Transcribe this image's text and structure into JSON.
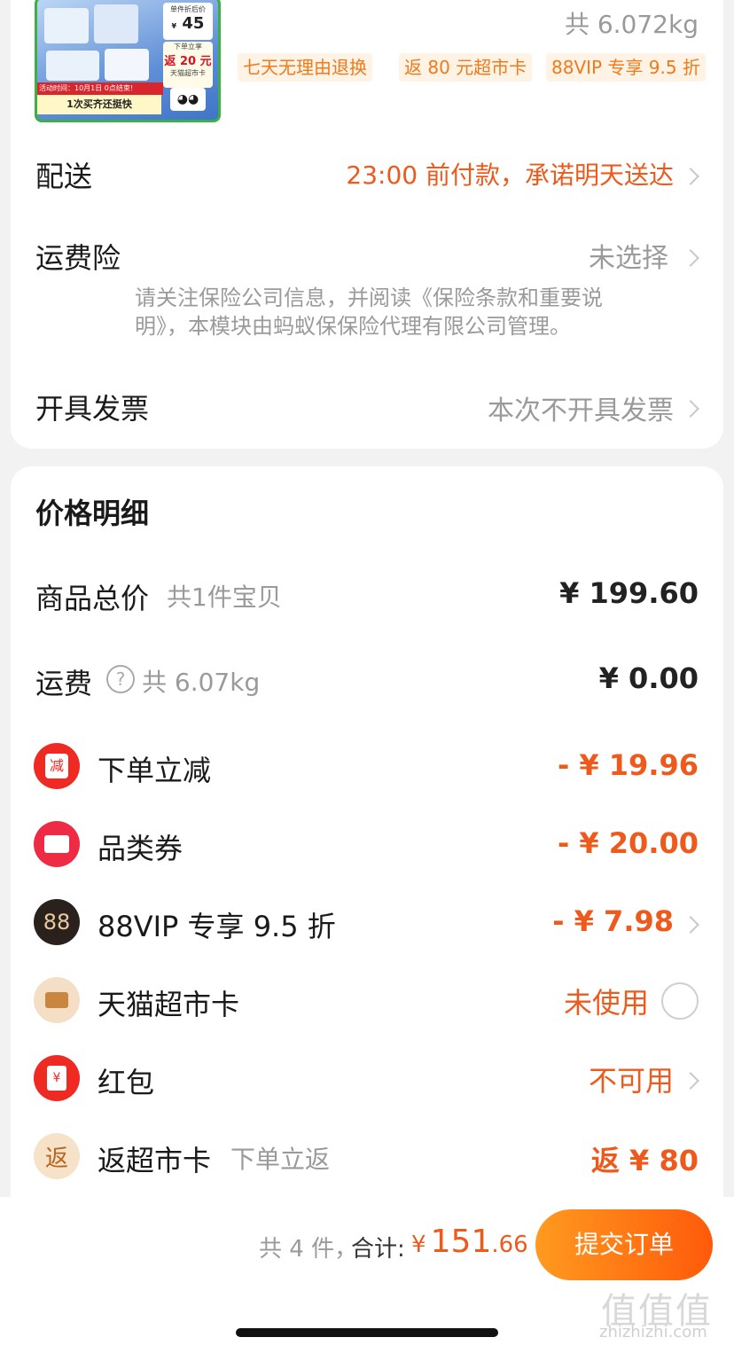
{
  "product": {
    "thumbnail": {
      "price_badge_title": "单件折后价",
      "price_badge_currency": "¥",
      "price_badge_value": "45",
      "rebate_line1": "下单立享",
      "rebate_line2": "返 20 元",
      "rebate_line3": "天猫超市卡",
      "event_text": "活动时间：10月1日 0点结束!",
      "slogan": "1次买齐还挺快"
    },
    "weight": "共 6.072kg",
    "tags": [
      "七天无理由退换",
      "返 80 元超市卡",
      "88VIP 专享 9.5 折"
    ]
  },
  "delivery": {
    "label": "配送",
    "value": "23:00 前付款，承诺明天送达"
  },
  "insurance": {
    "label": "运费险",
    "value": "未选择",
    "note_line1": "请关注保险公司信息，并阅读《保险条款和重要说",
    "note_line2": "明》，本模块由蚂蚁保保险代理有限公司管理。"
  },
  "invoice": {
    "label": "开具发票",
    "value": "本次不开具发票"
  },
  "price_detail": {
    "title": "价格明细",
    "goods_total": {
      "label": "商品总价",
      "sub": "共1件宝贝",
      "value": "¥ 199.60"
    },
    "shipping": {
      "label": "运费",
      "help_icon": "question-circle-icon",
      "sub": "共 6.07kg",
      "value": "¥ 0.00"
    },
    "discounts": [
      {
        "icon": "reduce-icon",
        "icon_text": "减",
        "label": "下单立减",
        "value": "- ¥ 19.96",
        "color": "#ee5a1c"
      },
      {
        "icon": "coupon-icon",
        "icon_text": "",
        "label": "品类券",
        "value": "- ¥ 20.00",
        "color": "#ee5a1c"
      },
      {
        "icon": "vip-88-icon",
        "icon_text": "88",
        "label": "88VIP 专享 9.5 折",
        "value": "- ¥ 7.98",
        "color": "#ee5a1c"
      },
      {
        "icon": "card-icon",
        "icon_text": "",
        "label": "天猫超市卡",
        "value": "未使用",
        "color": "#ee5a1c"
      },
      {
        "icon": "red-packet-icon",
        "icon_text": "¥",
        "label": "红包",
        "value": "不可用",
        "color": "#ee5a1c"
      },
      {
        "icon": "rebate-icon",
        "icon_text": "返",
        "label": "返超市卡",
        "sub": "下单立返",
        "value": "返 ¥ 80",
        "color": "#ee5a1c"
      }
    ]
  },
  "footer": {
    "count_text": "共 4 件，",
    "total_label": "合计:",
    "currency": "¥",
    "total_int": "151",
    "total_dec": ".66",
    "submit_label": "提交订单"
  },
  "watermark": {
    "logo": "值值值",
    "site": "zhizhizhi.com"
  },
  "colors": {
    "accent": "#ee5a1c",
    "button_from": "#ff9a1f",
    "button_to": "#ff5a0a"
  }
}
